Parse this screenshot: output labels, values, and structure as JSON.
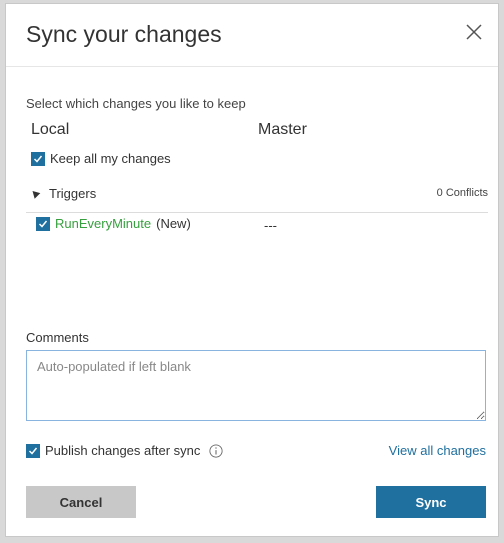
{
  "dialog": {
    "title": "Sync your changes",
    "instruction": "Select which changes you like to keep",
    "columns": {
      "local": "Local",
      "master": "Master"
    },
    "keep_all": {
      "label": "Keep all my changes",
      "checked": true
    },
    "section": {
      "name": "Triggers",
      "conflicts": "0 Conflicts",
      "expanded": true
    },
    "changes": [
      {
        "name": "RunEveryMinute",
        "tag": "(New)",
        "master": "---",
        "checked": true
      }
    ],
    "comments": {
      "label": "Comments",
      "placeholder": "Auto-populated if left blank",
      "value": ""
    },
    "publish": {
      "label": "Publish changes after sync",
      "checked": true
    },
    "view_all_link": "View all changes",
    "buttons": {
      "cancel": "Cancel",
      "sync": "Sync"
    },
    "colors": {
      "accent": "#1f6f9f",
      "new_item": "#36a03e",
      "cancel_bg": "#c8c8c8"
    }
  }
}
